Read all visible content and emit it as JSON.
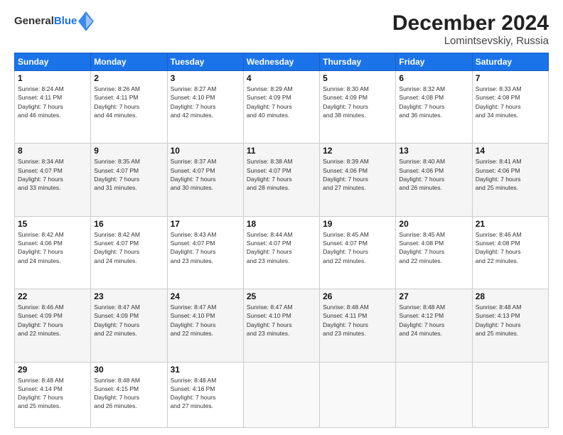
{
  "logo": {
    "general": "General",
    "blue": "Blue"
  },
  "title": "December 2024",
  "subtitle": "Lomintsevskiy, Russia",
  "headers": [
    "Sunday",
    "Monday",
    "Tuesday",
    "Wednesday",
    "Thursday",
    "Friday",
    "Saturday"
  ],
  "weeks": [
    [
      {
        "day": "1",
        "lines": [
          "Sunrise: 8:24 AM",
          "Sunset: 4:11 PM",
          "Daylight: 7 hours",
          "and 46 minutes."
        ]
      },
      {
        "day": "2",
        "lines": [
          "Sunrise: 8:26 AM",
          "Sunset: 4:11 PM",
          "Daylight: 7 hours",
          "and 44 minutes."
        ]
      },
      {
        "day": "3",
        "lines": [
          "Sunrise: 8:27 AM",
          "Sunset: 4:10 PM",
          "Daylight: 7 hours",
          "and 42 minutes."
        ]
      },
      {
        "day": "4",
        "lines": [
          "Sunrise: 8:29 AM",
          "Sunset: 4:09 PM",
          "Daylight: 7 hours",
          "and 40 minutes."
        ]
      },
      {
        "day": "5",
        "lines": [
          "Sunrise: 8:30 AM",
          "Sunset: 4:09 PM",
          "Daylight: 7 hours",
          "and 38 minutes."
        ]
      },
      {
        "day": "6",
        "lines": [
          "Sunrise: 8:32 AM",
          "Sunset: 4:08 PM",
          "Daylight: 7 hours",
          "and 36 minutes."
        ]
      },
      {
        "day": "7",
        "lines": [
          "Sunrise: 8:33 AM",
          "Sunset: 4:08 PM",
          "Daylight: 7 hours",
          "and 34 minutes."
        ]
      }
    ],
    [
      {
        "day": "8",
        "lines": [
          "Sunrise: 8:34 AM",
          "Sunset: 4:07 PM",
          "Daylight: 7 hours",
          "and 33 minutes."
        ]
      },
      {
        "day": "9",
        "lines": [
          "Sunrise: 8:35 AM",
          "Sunset: 4:07 PM",
          "Daylight: 7 hours",
          "and 31 minutes."
        ]
      },
      {
        "day": "10",
        "lines": [
          "Sunrise: 8:37 AM",
          "Sunset: 4:07 PM",
          "Daylight: 7 hours",
          "and 30 minutes."
        ]
      },
      {
        "day": "11",
        "lines": [
          "Sunrise: 8:38 AM",
          "Sunset: 4:07 PM",
          "Daylight: 7 hours",
          "and 28 minutes."
        ]
      },
      {
        "day": "12",
        "lines": [
          "Sunrise: 8:39 AM",
          "Sunset: 4:06 PM",
          "Daylight: 7 hours",
          "and 27 minutes."
        ]
      },
      {
        "day": "13",
        "lines": [
          "Sunrise: 8:40 AM",
          "Sunset: 4:06 PM",
          "Daylight: 7 hours",
          "and 26 minutes."
        ]
      },
      {
        "day": "14",
        "lines": [
          "Sunrise: 8:41 AM",
          "Sunset: 4:06 PM",
          "Daylight: 7 hours",
          "and 25 minutes."
        ]
      }
    ],
    [
      {
        "day": "15",
        "lines": [
          "Sunrise: 8:42 AM",
          "Sunset: 4:06 PM",
          "Daylight: 7 hours",
          "and 24 minutes."
        ]
      },
      {
        "day": "16",
        "lines": [
          "Sunrise: 8:42 AM",
          "Sunset: 4:07 PM",
          "Daylight: 7 hours",
          "and 24 minutes."
        ]
      },
      {
        "day": "17",
        "lines": [
          "Sunrise: 8:43 AM",
          "Sunset: 4:07 PM",
          "Daylight: 7 hours",
          "and 23 minutes."
        ]
      },
      {
        "day": "18",
        "lines": [
          "Sunrise: 8:44 AM",
          "Sunset: 4:07 PM",
          "Daylight: 7 hours",
          "and 23 minutes."
        ]
      },
      {
        "day": "19",
        "lines": [
          "Sunrise: 8:45 AM",
          "Sunset: 4:07 PM",
          "Daylight: 7 hours",
          "and 22 minutes."
        ]
      },
      {
        "day": "20",
        "lines": [
          "Sunrise: 8:45 AM",
          "Sunset: 4:08 PM",
          "Daylight: 7 hours",
          "and 22 minutes."
        ]
      },
      {
        "day": "21",
        "lines": [
          "Sunrise: 8:46 AM",
          "Sunset: 4:08 PM",
          "Daylight: 7 hours",
          "and 22 minutes."
        ]
      }
    ],
    [
      {
        "day": "22",
        "lines": [
          "Sunrise: 8:46 AM",
          "Sunset: 4:09 PM",
          "Daylight: 7 hours",
          "and 22 minutes."
        ]
      },
      {
        "day": "23",
        "lines": [
          "Sunrise: 8:47 AM",
          "Sunset: 4:09 PM",
          "Daylight: 7 hours",
          "and 22 minutes."
        ]
      },
      {
        "day": "24",
        "lines": [
          "Sunrise: 8:47 AM",
          "Sunset: 4:10 PM",
          "Daylight: 7 hours",
          "and 22 minutes."
        ]
      },
      {
        "day": "25",
        "lines": [
          "Sunrise: 8:47 AM",
          "Sunset: 4:10 PM",
          "Daylight: 7 hours",
          "and 23 minutes."
        ]
      },
      {
        "day": "26",
        "lines": [
          "Sunrise: 8:48 AM",
          "Sunset: 4:11 PM",
          "Daylight: 7 hours",
          "and 23 minutes."
        ]
      },
      {
        "day": "27",
        "lines": [
          "Sunrise: 8:48 AM",
          "Sunset: 4:12 PM",
          "Daylight: 7 hours",
          "and 24 minutes."
        ]
      },
      {
        "day": "28",
        "lines": [
          "Sunrise: 8:48 AM",
          "Sunset: 4:13 PM",
          "Daylight: 7 hours",
          "and 25 minutes."
        ]
      }
    ],
    [
      {
        "day": "29",
        "lines": [
          "Sunrise: 8:48 AM",
          "Sunset: 4:14 PM",
          "Daylight: 7 hours",
          "and 25 minutes."
        ]
      },
      {
        "day": "30",
        "lines": [
          "Sunrise: 8:48 AM",
          "Sunset: 4:15 PM",
          "Daylight: 7 hours",
          "and 26 minutes."
        ]
      },
      {
        "day": "31",
        "lines": [
          "Sunrise: 8:48 AM",
          "Sunset: 4:16 PM",
          "Daylight: 7 hours",
          "and 27 minutes."
        ]
      },
      null,
      null,
      null,
      null
    ]
  ]
}
